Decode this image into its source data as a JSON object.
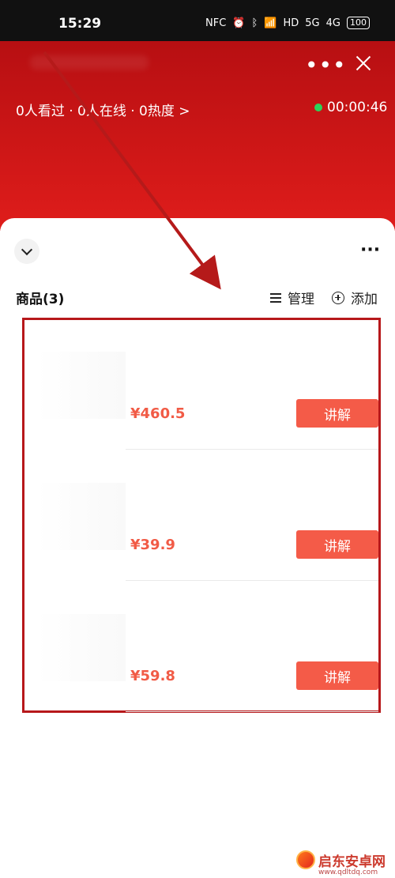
{
  "status_bar": {
    "time": "15:29",
    "icons": [
      "NFC",
      "alarm-icon",
      "bluetooth-icon",
      "wifi-icon",
      "HD",
      "5G",
      "4G"
    ],
    "battery": "100"
  },
  "live_header": {
    "stats": "0人看过 · 0人在线 · 0热度 >",
    "timer": "00:00:46",
    "more_icon": "more-icon",
    "close_icon": "close-icon"
  },
  "product_panel": {
    "section_title": "商品(3)",
    "manage_label": "管理",
    "add_label": "添加",
    "items": [
      {
        "price": "¥460.5",
        "button_label": "讲解"
      },
      {
        "price": "¥39.9",
        "button_label": "讲解"
      },
      {
        "price": "¥59.8",
        "button_label": "讲解"
      }
    ]
  },
  "watermark": {
    "text": "启东安卓网",
    "url": "www.qdltdq.com"
  },
  "colors": {
    "header_red": "#cf1717",
    "highlight_box": "#b7181b",
    "price_red": "#f15b46",
    "button_red": "#f45b48",
    "live_dot": "#2bd45b"
  }
}
